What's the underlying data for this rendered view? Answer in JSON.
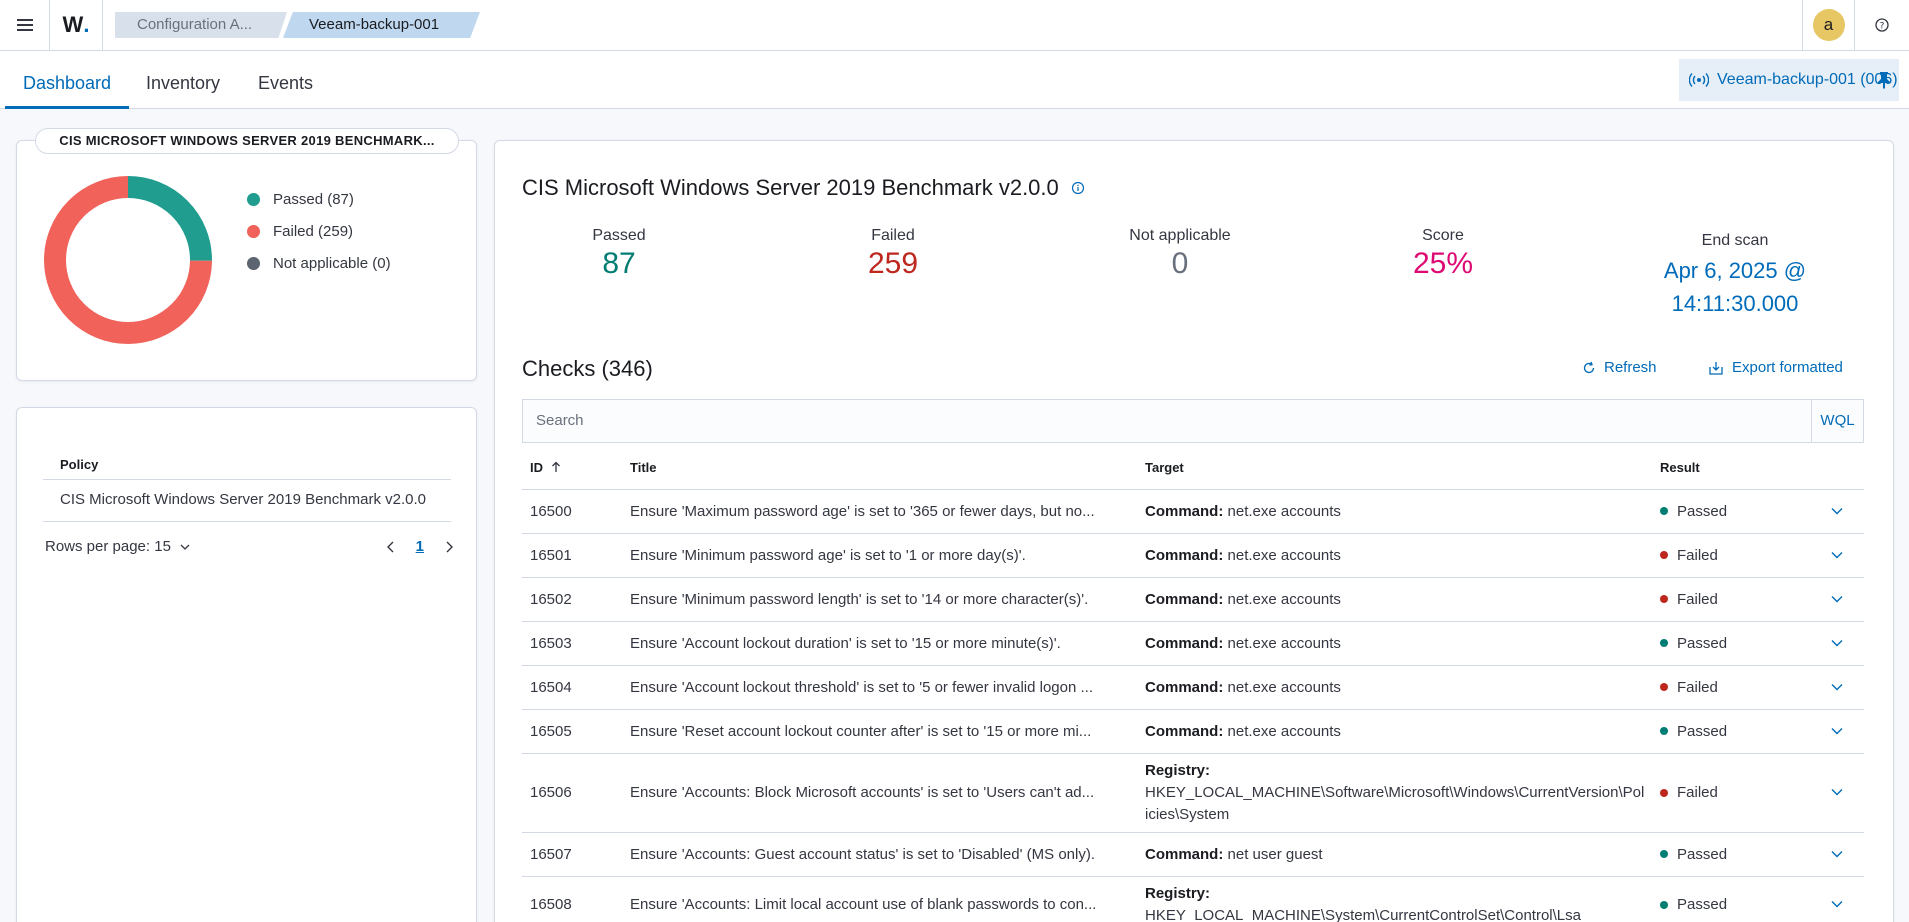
{
  "header": {
    "logo_text": "W",
    "logo_dot": ".",
    "breadcrumbs": [
      "Configuration A...",
      "Veeam-backup-001"
    ],
    "avatar_initial": "a",
    "help_icon": "question-circle-icon"
  },
  "tabs": [
    {
      "label": "Dashboard",
      "active": true
    },
    {
      "label": "Inventory",
      "active": false
    },
    {
      "label": "Events",
      "active": false
    }
  ],
  "agent": {
    "label": "Veeam-backup-001 (006)"
  },
  "summary": {
    "title": "CIS MICROSOFT WINDOWS SERVER 2019 BENCHMARK...",
    "legend": [
      {
        "label": "Passed (87)",
        "color": "#209d8f"
      },
      {
        "label": "Failed (259)",
        "color": "#f0625a"
      },
      {
        "label": "Not applicable (0)",
        "color": "#5b6470"
      }
    ]
  },
  "policy_table": {
    "header": "Policy",
    "rows": [
      "CIS Microsoft Windows Server 2019 Benchmark v2.0.0"
    ],
    "rows_per_page": "Rows per page: 15",
    "current_page": "1"
  },
  "main": {
    "title": "CIS Microsoft Windows Server 2019 Benchmark v2.0.0",
    "stats": {
      "passed_label": "Passed",
      "passed_value": "87",
      "passed_color": "#017d73",
      "failed_label": "Failed",
      "failed_value": "259",
      "failed_color": "#bd271e",
      "na_label": "Not applicable",
      "na_value": "0",
      "na_color": "#69707d",
      "score_label": "Score",
      "score_value": "25%",
      "score_color": "#dd0a73",
      "endscan_label": "End scan",
      "endscan_value_line1": "Apr 6, 2025 @",
      "endscan_value_line2": "14:11:30.000",
      "endscan_color": "#006bb8"
    },
    "checks_title": "Checks (346)",
    "refresh_label": "Refresh",
    "export_label": "Export formatted",
    "search_placeholder": "Search",
    "wql_label": "WQL",
    "columns": {
      "id": "ID",
      "title": "Title",
      "target": "Target",
      "result": "Result"
    },
    "rows": [
      {
        "id": "16500",
        "title": "Ensure 'Maximum password age' is set to '365 or fewer days, but no...",
        "target_key": "Command:",
        "target_val": "net.exe accounts",
        "result": "Passed"
      },
      {
        "id": "16501",
        "title": "Ensure 'Minimum password age' is set to '1 or more day(s)'.",
        "target_key": "Command:",
        "target_val": "net.exe accounts",
        "result": "Failed"
      },
      {
        "id": "16502",
        "title": "Ensure 'Minimum password length' is set to '14 or more character(s)'.",
        "target_key": "Command:",
        "target_val": "net.exe accounts",
        "result": "Failed"
      },
      {
        "id": "16503",
        "title": "Ensure 'Account lockout duration' is set to '15 or more minute(s)'.",
        "target_key": "Command:",
        "target_val": "net.exe accounts",
        "result": "Passed"
      },
      {
        "id": "16504",
        "title": "Ensure 'Account lockout threshold' is set to '5 or fewer invalid logon ...",
        "target_key": "Command:",
        "target_val": "net.exe accounts",
        "result": "Failed"
      },
      {
        "id": "16505",
        "title": "Ensure 'Reset account lockout counter after' is set to '15 or more mi...",
        "target_key": "Command:",
        "target_val": "net.exe accounts",
        "result": "Passed"
      },
      {
        "id": "16506",
        "title": "Ensure 'Accounts: Block Microsoft accounts' is set to 'Users can't ad...",
        "target_key": "Registry:",
        "target_val": "HKEY_LOCAL_MACHINE\\Software\\Microsoft\\Windows\\CurrentVersion\\Policies\\System",
        "result": "Failed"
      },
      {
        "id": "16507",
        "title": "Ensure 'Accounts: Guest account status' is set to 'Disabled' (MS only).",
        "target_key": "Command:",
        "target_val": "net user guest",
        "result": "Passed"
      },
      {
        "id": "16508",
        "title": "Ensure 'Accounts: Limit local account use of blank passwords to con...",
        "target_key": "Registry:",
        "target_val": "HKEY_LOCAL_MACHINE\\System\\CurrentControlSet\\Control\\Lsa",
        "result": "Passed"
      }
    ]
  },
  "colors": {
    "passed": "#017d73",
    "failed": "#bd271e",
    "accent": "#006bb8"
  }
}
